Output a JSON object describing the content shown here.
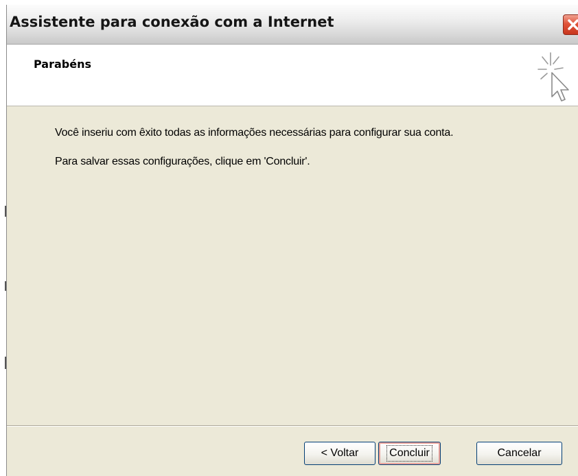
{
  "window": {
    "title": "Assistente para conexão com a Internet",
    "close_icon": "close-icon",
    "close_color": "#d9472b"
  },
  "header": {
    "title": "Parabéns",
    "icon": "sparkle-cursor-icon"
  },
  "content": {
    "line1": "Você inseriu com êxito todas as informações necessárias para configurar sua conta.",
    "line2": "Para salvar essas configurações, clique em 'Concluir'."
  },
  "buttons": {
    "back_label": "< Voltar",
    "finish_label": "Concluir",
    "cancel_label": "Cancelar"
  },
  "colors": {
    "dialog_background": "#ece9d8",
    "header_background": "#ffffff",
    "button_border": "#003c74",
    "default_button_highlight": "#e9a39b"
  }
}
